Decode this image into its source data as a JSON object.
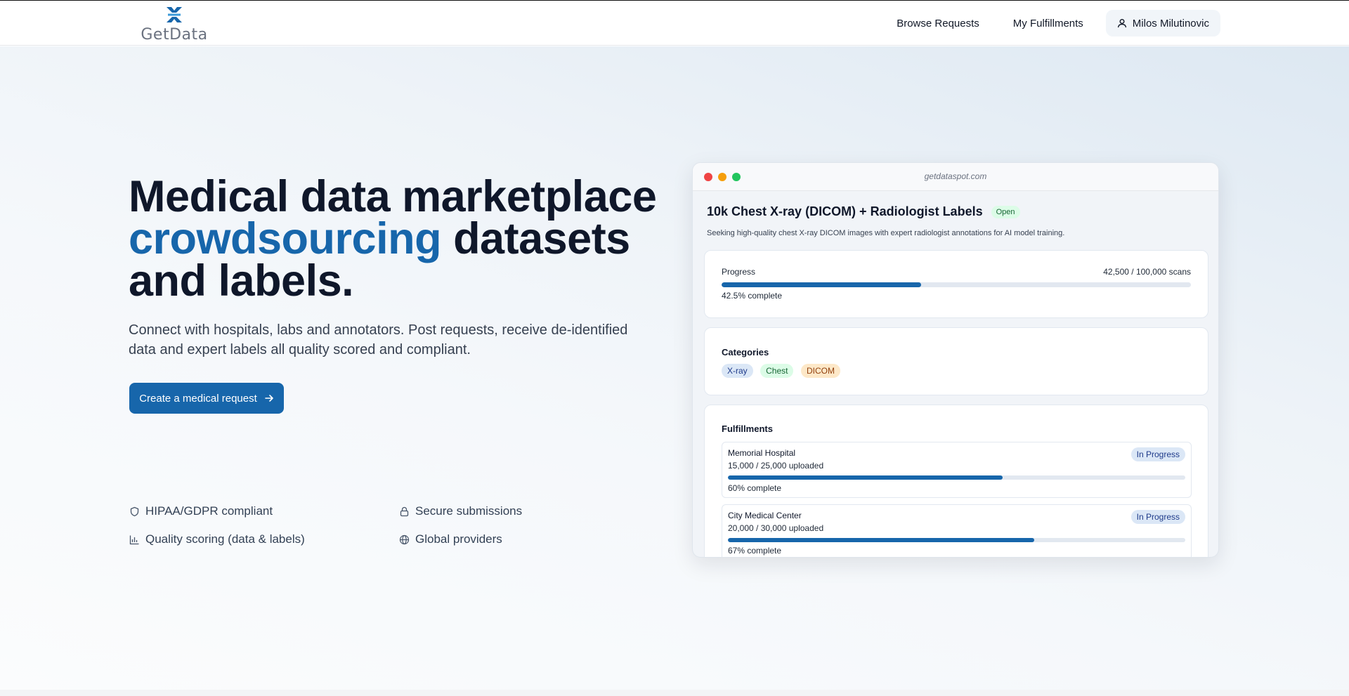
{
  "header": {
    "logo_text": "GetData",
    "nav": {
      "browse": "Browse Requests",
      "fulfillments": "My Fulfillments",
      "user_name": "Milos Milutinovic"
    }
  },
  "hero": {
    "title_line1": "Medical data marketplace",
    "title_accent": "crowdsourcing",
    "title_rest": "datasets",
    "title_line3": "and labels.",
    "subtitle": "Connect with hospitals, labs and annotators. Post requests, receive de-identified data and expert labels all quality scored and compliant.",
    "cta_label": "Create a medical request",
    "features": [
      {
        "label": "HIPAA/GDPR compliant",
        "icon": "shield-icon"
      },
      {
        "label": "Secure submissions",
        "icon": "lock-icon"
      },
      {
        "label": "Quality scoring (data & labels)",
        "icon": "bar-chart-icon"
      },
      {
        "label": "Global providers",
        "icon": "globe-icon"
      }
    ]
  },
  "preview": {
    "url": "getdataspot.com",
    "title": "10k Chest X-ray (DICOM) + Radiologist Labels",
    "status": "Open",
    "description": "Seeking high-quality chest X-ray DICOM images with expert radiologist annotations for AI model training.",
    "progress": {
      "label": "Progress",
      "count": "42,500 / 100,000 scans",
      "percent": 42.5,
      "complete_text": "42.5% complete"
    },
    "categories": {
      "heading": "Categories",
      "tags": [
        "X-ray",
        "Chest",
        "DICOM"
      ]
    },
    "fulfillments": {
      "heading": "Fulfillments",
      "items": [
        {
          "name": "Memorial Hospital",
          "count": "15,000 / 25,000 uploaded",
          "status": "In Progress",
          "percent": 60,
          "complete_text": "60% complete"
        },
        {
          "name": "City Medical Center",
          "count": "20,000 / 30,000 uploaded",
          "status": "In Progress",
          "percent": 67,
          "complete_text": "67% complete"
        }
      ]
    }
  },
  "colors": {
    "accent": "#1766ab",
    "open_badge_bg": "#dcfce7",
    "open_badge_text": "#166534",
    "tag_xray_bg": "#dbe7f6",
    "tag_chest_bg": "#dcfce7",
    "tag_dicom_bg": "#fde8c8"
  }
}
